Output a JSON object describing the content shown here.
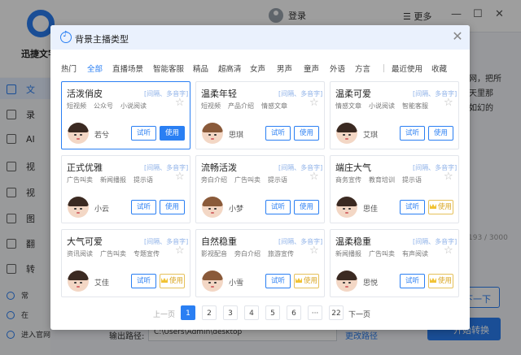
{
  "app": {
    "logo_text": "迅捷文字",
    "login": "登录",
    "more": "更多",
    "sidebar": [
      "文",
      "录",
      "AI",
      "视",
      "视",
      "图",
      "翻",
      "转"
    ],
    "sidebar_bottom": [
      "常",
      "在",
      "进入官网"
    ],
    "right_text": [
      "的网，把所",
      "白天里那",
      "梦如幻的"
    ],
    "char_count": "193 / 3000",
    "next_button": "下一下",
    "start_button": "开始转换",
    "output_label": "输出路径:",
    "output_path": "C:\\Users\\Admin\\desktop",
    "change_path": "更改路径"
  },
  "modal": {
    "title": "背景主播类型",
    "tabs": [
      "热门",
      "全部",
      "直播场景",
      "智能客服",
      "精品",
      "超高清",
      "女声",
      "男声",
      "童声",
      "外语",
      "方言",
      "最近使用",
      "收藏"
    ],
    "active_tab": "全部",
    "listen_label": "试听",
    "use_label": "使用",
    "cards": [
      {
        "name": "活泼俏皮",
        "tag": "[间隔、多音字]",
        "cats": [
          "短视频",
          "公众号",
          "小说阅读"
        ],
        "voice": "若兮",
        "use": "primary",
        "selected": true
      },
      {
        "name": "温柔年轻",
        "tag": "[间隔、多音字]",
        "cats": [
          "短视频",
          "产品介绍",
          "情感文章"
        ],
        "voice": "思琪",
        "use": "normal",
        "selected": false
      },
      {
        "name": "温柔可爱",
        "tag": "[间隔、多音字]",
        "cats": [
          "情感文章",
          "小说阅读",
          "智能客服"
        ],
        "voice": "艾琪",
        "use": "normal",
        "selected": false
      },
      {
        "name": "正式优雅",
        "tag": "[间隔、多音字]",
        "cats": [
          "广告叫卖",
          "新闻播报",
          "提示语"
        ],
        "voice": "小云",
        "use": "normal",
        "selected": false
      },
      {
        "name": "流畅活泼",
        "tag": "[间隔、多音字]",
        "cats": [
          "旁白介绍",
          "广告叫卖",
          "提示语"
        ],
        "voice": "小梦",
        "use": "normal",
        "selected": false
      },
      {
        "name": "端庄大气",
        "tag": "[间隔、多音字]",
        "cats": [
          "商务宣传",
          "教育培训",
          "提示语"
        ],
        "voice": "思佳",
        "use": "vip",
        "selected": false
      },
      {
        "name": "大气可爱",
        "tag": "[间隔、多音字]",
        "cats": [
          "资讯阅读",
          "广告叫卖",
          "专题宣传"
        ],
        "voice": "艾佳",
        "use": "vip",
        "selected": false
      },
      {
        "name": "自然稳重",
        "tag": "[间隔、多音字]",
        "cats": [
          "影视配音",
          "旁白介绍",
          "旅游宣传"
        ],
        "voice": "小雪",
        "use": "vip",
        "selected": false
      },
      {
        "name": "温柔稳重",
        "tag": "[间隔、多音字]",
        "cats": [
          "新闻播报",
          "广告叫卖",
          "有声阅读"
        ],
        "voice": "思悦",
        "use": "vip",
        "selected": false
      }
    ],
    "pager": {
      "prev": "上一页",
      "pages": [
        "1",
        "2",
        "3",
        "4",
        "5",
        "6",
        "···",
        "22"
      ],
      "current": "1",
      "next": "下一页"
    }
  }
}
